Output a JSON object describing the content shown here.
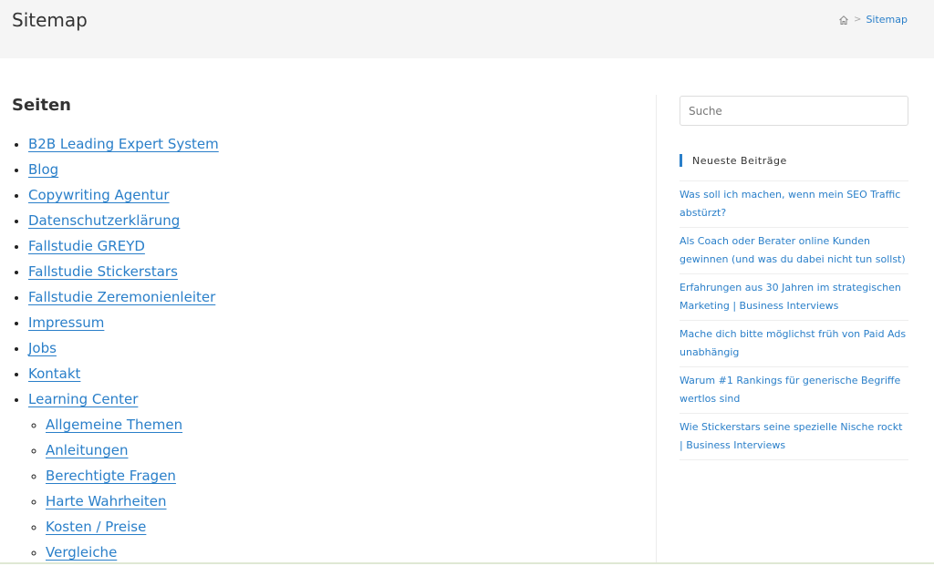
{
  "header": {
    "title": "Sitemap",
    "breadcrumb": {
      "home_icon": "home-icon",
      "separator": ">",
      "current": "Sitemap"
    }
  },
  "main": {
    "heading": "Seiten",
    "pages": [
      "B2B Leading Expert System",
      "Blog",
      "Copywriting Agentur",
      "Datenschutzerklärung",
      "Fallstudie GREYD",
      "Fallstudie Stickerstars",
      "Fallstudie Zeremonienleiter",
      "Impressum",
      "Jobs",
      "Kontakt",
      "Learning Center"
    ],
    "learning_center_children": [
      "Allgemeine Themen",
      "Anleitungen",
      "Berechtigte Fragen",
      "Harte Wahrheiten",
      "Kosten / Preise",
      "Vergleiche"
    ]
  },
  "sidebar": {
    "search_placeholder": "Suche",
    "widget_title": "Neueste Beiträge",
    "recent_posts": [
      "Was soll ich machen, wenn mein SEO Traffic abstürzt?",
      "Als Coach oder Berater online Kunden gewinnen (und was du dabei nicht tun sollst)",
      "Erfahrungen aus 30 Jahren im strategischen Marketing | Business Interviews",
      "Mache dich bitte möglichst früh von Paid Ads unabhängig",
      "Warum #1 Rankings für generische Begriffe wertlos sind",
      "Wie Stickerstars seine spezielle Nische rockt | Business Interviews"
    ]
  },
  "colors": {
    "accent": "#2a7fc9",
    "header_bg": "#f5f5f5",
    "text": "#333333"
  }
}
